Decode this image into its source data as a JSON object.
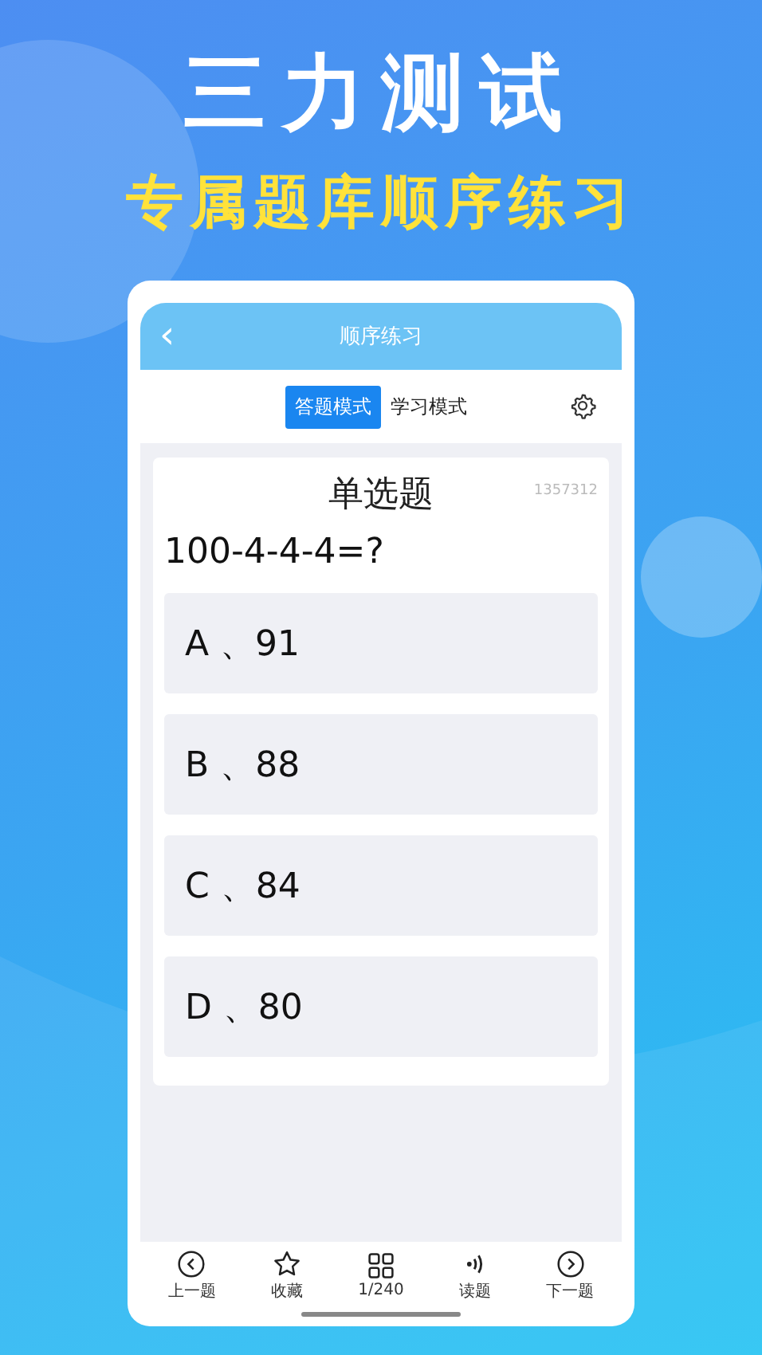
{
  "headline": "三力测试",
  "subheadline": "专属题库顺序练习",
  "phone": {
    "title": "顺序练习",
    "back": "‹",
    "modes": [
      {
        "label": "答题模式",
        "selected": true
      },
      {
        "label": "学习模式",
        "selected": false
      }
    ],
    "question": {
      "type": "单选题",
      "id": "1357312",
      "text": "100-4-4-4=?",
      "options": [
        {
          "label": "A 、91",
          "selected": false
        },
        {
          "label": "B 、88",
          "selected": false
        },
        {
          "label": "C 、84",
          "selected": false
        },
        {
          "label": "D 、80",
          "selected": false
        }
      ]
    },
    "nav": [
      {
        "kind": "prev",
        "label": "上一题"
      },
      {
        "kind": "star",
        "label": "收藏"
      },
      {
        "kind": "grid",
        "label": "1/240"
      },
      {
        "kind": "sound",
        "label": "读题"
      },
      {
        "kind": "next",
        "label": "下一题"
      }
    ]
  }
}
